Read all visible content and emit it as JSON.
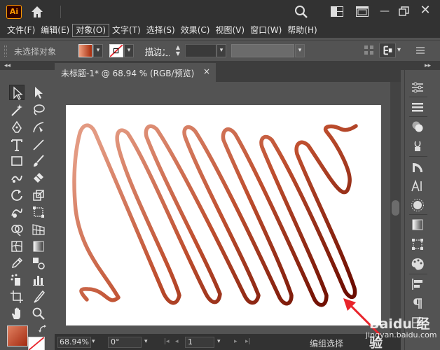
{
  "app": {
    "logo_text": "Ai",
    "window_controls": [
      "minimize-icon",
      "maximize-icon",
      "close-icon"
    ]
  },
  "menubar": {
    "items": [
      {
        "label": "文件(F)"
      },
      {
        "label": "编辑(E)"
      },
      {
        "label": "对象(O)",
        "active": true
      },
      {
        "label": "文字(T)"
      },
      {
        "label": "选择(S)"
      },
      {
        "label": "效果(C)"
      },
      {
        "label": "视图(V)"
      },
      {
        "label": "窗口(W)"
      },
      {
        "label": "帮助(H)"
      }
    ]
  },
  "controlbar": {
    "selection_status": "未选择对象",
    "stroke_label": "描边：",
    "stroke_weight": "",
    "fill_color": "#c65a36"
  },
  "document": {
    "tab_title": "未标题-1* @ 68.94 % (RGB/预览)",
    "close_glyph": "×"
  },
  "statusbar": {
    "zoom": "68.94%",
    "rotation": "0°",
    "page": "1",
    "status_text": "编组选择"
  },
  "watermark": {
    "text": "Baidu 经验",
    "url": "jingyan.baidu.com"
  },
  "colors": {
    "accent_orange": "#ff9a00",
    "stroke_gradient_start": "#e39a82",
    "stroke_gradient_end": "#6b0c00",
    "annotation_red": "#e8242b"
  }
}
